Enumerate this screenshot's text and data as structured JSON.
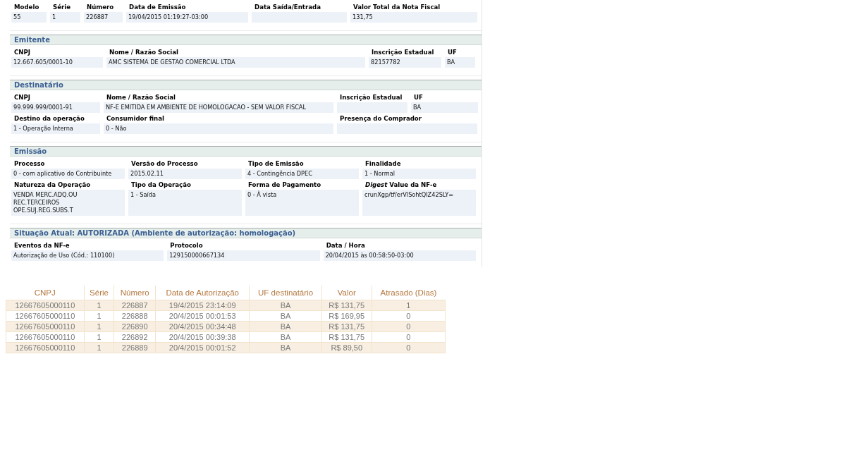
{
  "header": {
    "fields": [
      {
        "label": "Modelo",
        "value": "55"
      },
      {
        "label": "Série",
        "value": "1"
      },
      {
        "label": "Número",
        "value": "226887"
      },
      {
        "label": "Data de Emissão",
        "value": "19/04/2015 01:19:27-03:00"
      },
      {
        "label": "Data Saída/Entrada"
      },
      {
        "label": "Valor Total da Nota Fiscal",
        "value": "131,75"
      }
    ]
  },
  "sections": [
    {
      "title": "Emitente",
      "rows": [
        [
          {
            "label": "CNPJ",
            "value": "12.667.605/0001-10"
          },
          {
            "label": "Nome / Razão Social",
            "value": "AMC SISTEMA DE GESTAO COMERCIAL LTDA"
          },
          {
            "label": "Inscrição Estadual",
            "value": "82157782"
          },
          {
            "label": "UF",
            "value": "BA"
          }
        ]
      ]
    },
    {
      "title": "Destinatário",
      "rows": [
        [
          {
            "label": "CNPJ",
            "value": "99.999.999/0001-91"
          },
          {
            "label": "Nome / Razão Social",
            "value": "NF-E EMITIDA EM AMBIENTE DE HOMOLOGACAO - SEM VALOR FISCAL"
          },
          {
            "label": "Inscrição Estadual"
          },
          {
            "label": "UF",
            "value": "BA"
          }
        ],
        [
          {
            "label": "Destino da operação",
            "value": "1 - Operação Interna"
          },
          {
            "label": "Consumidor final",
            "value": "0 - Não"
          },
          {
            "label": "Presença do Comprador"
          }
        ]
      ]
    },
    {
      "title": "Emissão",
      "rows": [
        [
          {
            "label": "Processo",
            "value": "0 - com aplicativo do Contribuinte"
          },
          {
            "label": "Versão do Processo",
            "value": "2015.02.11"
          },
          {
            "label": "Tipo de Emissão",
            "value": "4 - Contingência DPEC"
          },
          {
            "label": "Finalidade",
            "value": "1 - Normal"
          }
        ],
        [
          {
            "label": "Natureza da Operação",
            "value": "VENDA MERC.ADQ.OU\nREC.TERCEIROS\nOPE.SUJ.REG.SUBS.T"
          },
          {
            "label": "Tipo da Operação",
            "value": "1 - Saída"
          },
          {
            "label": "Forma de Pagamento",
            "value": "0 - À vista"
          },
          {
            "label": "*Digest* Value da NF-e",
            "value": "crunXgp/tf/erVlSohtQIZ42SLY="
          }
        ]
      ]
    },
    {
      "title": "Situação Atual:  AUTORIZADA (Ambiente de autorização: homologação)",
      "rows": [
        [
          {
            "label": "Eventos da NF-e",
            "value": "Autorização de Uso (Cód.: 110100)"
          },
          {
            "label": "Protocolo",
            "value": "129150000667134"
          },
          {
            "label": "Data / Hora",
            "value": "20/04/2015 às 00:58:50-03:00"
          }
        ]
      ]
    }
  ],
  "events_table": {
    "columns": [
      "CNPJ",
      "Série",
      "Número",
      "Data de Autorização",
      "UF destinatário",
      "Valor",
      "Atrasado (Dias)"
    ],
    "rows": [
      [
        "12667605000110",
        "1",
        "226887",
        "19/4/2015 23:14:09",
        "BA",
        "R$ 131,75",
        "1"
      ],
      [
        "12667605000110",
        "1",
        "226888",
        "20/4/2015 00:01:53",
        "BA",
        "R$ 169,95",
        "0"
      ],
      [
        "12667605000110",
        "1",
        "226890",
        "20/4/2015 00:34:48",
        "BA",
        "R$ 131,75",
        "0"
      ],
      [
        "12667605000110",
        "1",
        "226892",
        "20/4/2015 00:39:38",
        "BA",
        "R$ 131,75",
        "0"
      ],
      [
        "12667605000110",
        "1",
        "226889",
        "20/4/2015 00:01:52",
        "BA",
        "R$ 89,50",
        "0"
      ]
    ]
  }
}
